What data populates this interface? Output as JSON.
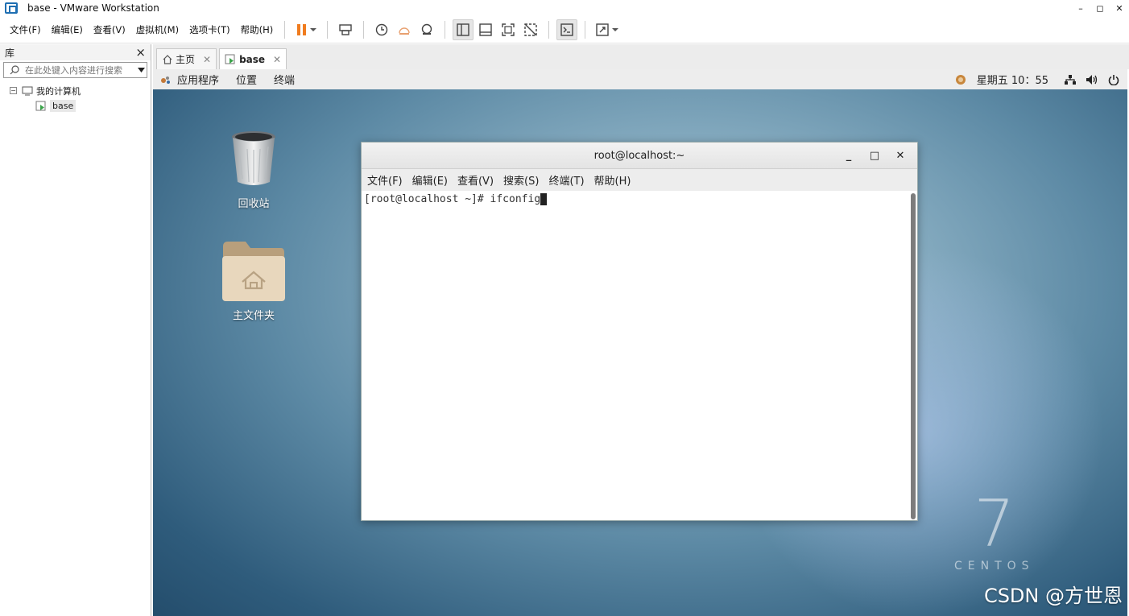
{
  "window": {
    "title": "base - VMware Workstation",
    "controls": [
      "–",
      "◻",
      "✕"
    ]
  },
  "menu": {
    "items": [
      "文件(F)",
      "编辑(E)",
      "查看(V)",
      "虚拟机(M)",
      "选项卡(T)",
      "帮助(H)"
    ]
  },
  "toolbar": {
    "icons": [
      "pause-icon",
      "send-ctrl-alt-del-icon",
      "snapshot-icon",
      "revert-snapshot-icon",
      "snapshot-manager-icon",
      "view-library-icon",
      "view-thumbnail-icon",
      "fullscreen-icon",
      "unity-icon",
      "console-icon",
      "stretch-icon"
    ],
    "accent": "#f07c1f"
  },
  "library": {
    "title": "库",
    "close": "×",
    "search_placeholder": "在此处键入内容进行搜索",
    "tree": {
      "root": "我的计算机",
      "child": "base"
    }
  },
  "tabs": [
    {
      "label": "主页",
      "close": "✕"
    },
    {
      "label": "base",
      "close": "✕"
    }
  ],
  "gnome": {
    "apps": "应用程序",
    "places": "位置",
    "terminal": "终端",
    "clock": "星期五 10：55"
  },
  "desktop": {
    "trash": "回收站",
    "home": "主文件夹"
  },
  "terminal": {
    "title": "root@localhost:~",
    "controls": [
      "_",
      "□",
      "✕"
    ],
    "menu": [
      "文件(F)",
      "编辑(E)",
      "查看(V)",
      "搜索(S)",
      "终端(T)",
      "帮助(H)"
    ],
    "prompt": "[root@localhost ~]# ifconfig"
  },
  "branding": {
    "version": "7",
    "name": "CENTOS"
  },
  "watermark": "CSDN @方世恩"
}
